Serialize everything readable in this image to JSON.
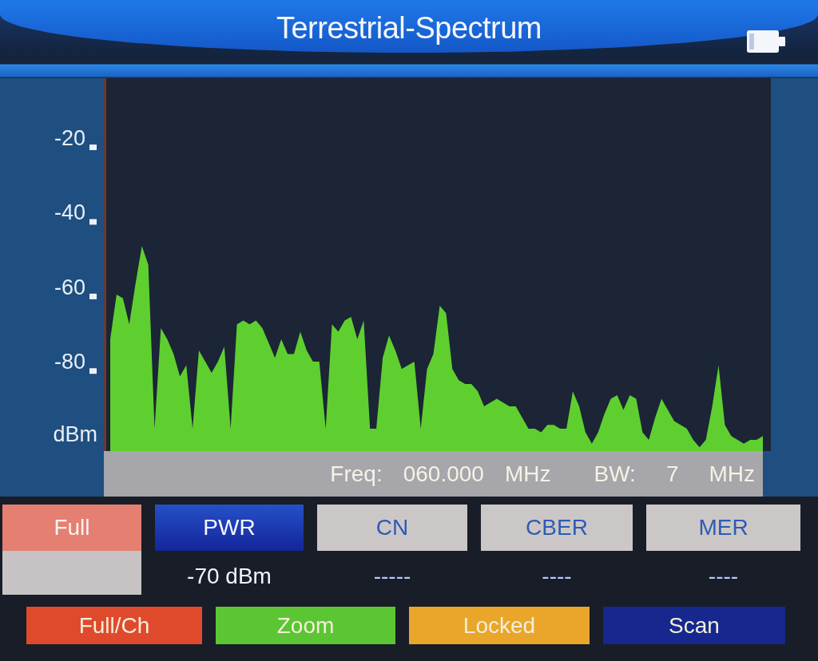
{
  "header": {
    "title": "Terrestrial-Spectrum"
  },
  "spectrum": {
    "y_axis_labels": [
      "-20",
      "-40",
      "-60",
      "-80"
    ],
    "unit_label": "dBm"
  },
  "info_bar": {
    "freq_label": "Freq:",
    "freq_value": "060.000",
    "freq_unit": "MHz",
    "bw_label": "BW:",
    "bw_value": "7",
    "bw_unit": "MHz"
  },
  "mode": {
    "label": "Full"
  },
  "measurements": [
    {
      "label": "PWR",
      "selected": true,
      "reading": "-70 dBm"
    },
    {
      "label": "CN",
      "selected": false,
      "reading": "-----"
    },
    {
      "label": "CBER",
      "selected": false,
      "reading": "----"
    },
    {
      "label": "MER",
      "selected": false,
      "reading": "----"
    }
  ],
  "function_keys": [
    {
      "label": "Full/Ch",
      "color": "#e04a2c"
    },
    {
      "label": "Zoom",
      "color": "#5cc534"
    },
    {
      "label": "Locked",
      "color": "#e9a62b"
    },
    {
      "label": "Scan",
      "color": "#16288e"
    }
  ]
}
